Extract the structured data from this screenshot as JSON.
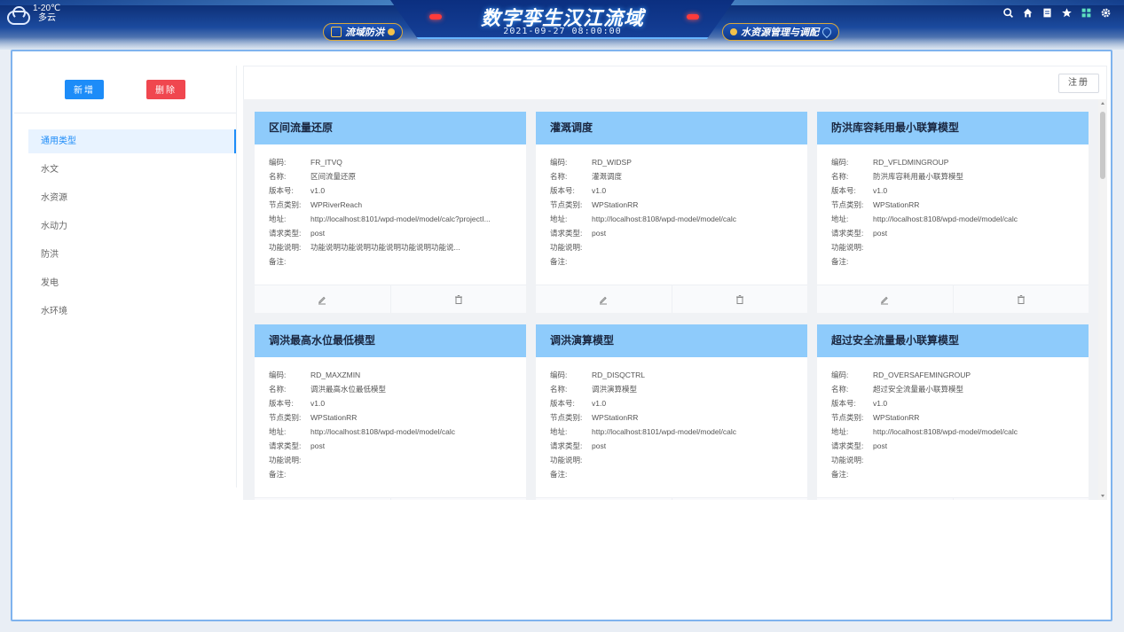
{
  "header": {
    "weather": {
      "temp": "1-20℃",
      "desc": "多云",
      "icon": "cloud-icon"
    },
    "title": "数字孪生汉江流域",
    "datetime": "2021-09-27 08:00:00",
    "nav_left": "流域防洪",
    "nav_right": "水资源管理与调配",
    "icons": [
      "search-icon",
      "home-icon",
      "document-icon",
      "star-icon",
      "grid-icon",
      "gear-icon"
    ]
  },
  "actions": {
    "add": "新增",
    "delete": "删除",
    "register": "注册"
  },
  "categories": [
    {
      "label": "通用类型",
      "active": true
    },
    {
      "label": "水文"
    },
    {
      "label": "水资源"
    },
    {
      "label": "水动力"
    },
    {
      "label": "防洪"
    },
    {
      "label": "发电"
    },
    {
      "label": "水环境"
    }
  ],
  "field_labels": {
    "code": "编码:",
    "name": "名称:",
    "version": "版本号:",
    "node_type": "节点类别:",
    "address": "地址:",
    "request_type": "请求类型:",
    "description": "功能说明:",
    "remark": "备注:"
  },
  "cards": [
    {
      "title": "区间流量还原",
      "code": "FR_ITVQ",
      "name": "区间流量还原",
      "version": "v1.0",
      "node_type": "WPRiverReach",
      "address": "http://localhost:8101/wpd-model/model/calc?projectI...",
      "request_type": "post",
      "description": "功能说明功能说明功能说明功能说明功能说...",
      "remark": ""
    },
    {
      "title": "灌溉调度",
      "code": "RD_WIDSP",
      "name": "灌溉调度",
      "version": "v1.0",
      "node_type": "WPStationRR",
      "address": "http://localhost:8108/wpd-model/model/calc",
      "request_type": "post",
      "description": "",
      "remark": ""
    },
    {
      "title": "防洪库容耗用最小联算模型",
      "code": "RD_VFLDMINGROUP",
      "name": "防洪库容耗用最小联算模型",
      "version": "v1.0",
      "node_type": "WPStationRR",
      "address": "http://localhost:8108/wpd-model/model/calc",
      "request_type": "post",
      "description": "",
      "remark": ""
    },
    {
      "title": "调洪最高水位最低模型",
      "code": "RD_MAXZMIN",
      "name": "调洪最高水位最低模型",
      "version": "v1.0",
      "node_type": "WPStationRR",
      "address": "http://localhost:8108/wpd-model/model/calc",
      "request_type": "post",
      "description": "",
      "remark": ""
    },
    {
      "title": "调洪演算模型",
      "code": "RD_DISQCTRL",
      "name": "调洪演算模型",
      "version": "v1.0",
      "node_type": "WPStationRR",
      "address": "http://localhost:8101/wpd-model/model/calc",
      "request_type": "post",
      "description": "",
      "remark": ""
    },
    {
      "title": "超过安全流量最小联算模型",
      "code": "RD_OVERSAFEMINGROUP",
      "name": "超过安全流量最小联算模型",
      "version": "v1.0",
      "node_type": "WPStationRR",
      "address": "http://localhost:8108/wpd-model/model/calc",
      "request_type": "post",
      "description": "",
      "remark": ""
    }
  ]
}
